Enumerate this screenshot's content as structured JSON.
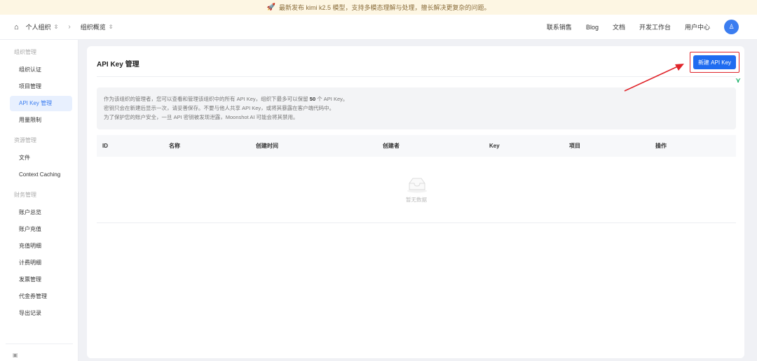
{
  "banner": {
    "text": "最新发布 kimi k2.5 模型，支持多模态理解与处理，擅长解决更复杂的问题。"
  },
  "topbar": {
    "org": "个人组织",
    "page": "组织概览",
    "links": [
      "联系销售",
      "Blog",
      "文档",
      "开发工作台",
      "用户中心"
    ]
  },
  "sidebar": {
    "groups": [
      {
        "label": "组织管理",
        "items": [
          "组织认证",
          "项目管理",
          "API Key 管理",
          "用量限制"
        ]
      },
      {
        "label": "资源管理",
        "items": [
          "文件",
          "Context Caching"
        ]
      },
      {
        "label": "财务管理",
        "items": [
          "账户总览",
          "账户充值",
          "充值明细",
          "计费明细",
          "发票管理",
          "代金券管理",
          "导出记录"
        ]
      }
    ],
    "active": "API Key 管理"
  },
  "main": {
    "title": "API Key 管理",
    "new_button": "新建 API Key",
    "info": {
      "line1_pre": "作为该组织的管理者，您可以查看和管理该组织中的所有 API Key，组织下最多可以保留",
      "line1_num": "50",
      "line1_post": "个 API Key。",
      "line2": "密钥只会在新建后显示一次，请妥善保存。不要与他人共享 API Key，或将其暴露在客户端代码中。",
      "line3": "为了保护您的账户安全，一旦 API 密钥被发现泄露，Moonshot AI 可能会将其禁用。"
    },
    "columns": [
      "ID",
      "名称",
      "创建时间",
      "创建者",
      "Key",
      "项目",
      "操作"
    ],
    "empty_text": "暂无数据"
  },
  "colors": {
    "accent": "#1f6cf0",
    "highlight": "#e0242a"
  }
}
